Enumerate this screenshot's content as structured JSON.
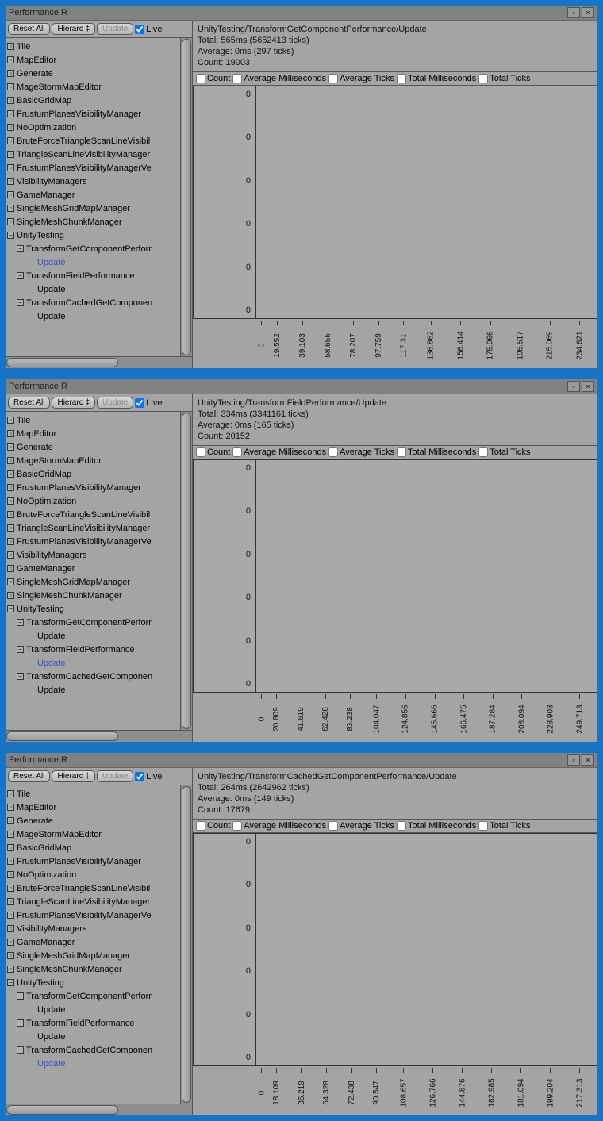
{
  "panels": [
    {
      "title": "Performance R",
      "toolbar": {
        "reset": "Reset All",
        "hierarchy": "Hierarc ‡",
        "update": "Update",
        "live": "Live"
      },
      "tree": [
        {
          "label": "Tile",
          "depth": 0,
          "icon": "square"
        },
        {
          "label": "MapEditor",
          "depth": 0,
          "icon": "square"
        },
        {
          "label": "Generate",
          "depth": 0,
          "icon": "square"
        },
        {
          "label": "MageStormMapEditor",
          "depth": 0,
          "icon": "square"
        },
        {
          "label": "BasicGridMap",
          "depth": 0,
          "icon": "square"
        },
        {
          "label": "FrustumPlanesVisibilityManager",
          "depth": 0,
          "icon": "square"
        },
        {
          "label": "NoOptimization",
          "depth": 0,
          "icon": "square"
        },
        {
          "label": "BruteForceTriangleScanLineVisibil",
          "depth": 0,
          "icon": "square"
        },
        {
          "label": "TriangleScanLineVisibilityManager",
          "depth": 0,
          "icon": "square"
        },
        {
          "label": "FrustumPlanesVisibilityManagerVe",
          "depth": 0,
          "icon": "square"
        },
        {
          "label": "VisibilityManagers",
          "depth": 0,
          "icon": "square"
        },
        {
          "label": "GameManager",
          "depth": 0,
          "icon": "square"
        },
        {
          "label": "SingleMeshGridMapManager",
          "depth": 0,
          "icon": "square"
        },
        {
          "label": "SingleMeshChunkManager",
          "depth": 0,
          "icon": "square"
        },
        {
          "label": "UnityTesting",
          "depth": 0,
          "icon": "minus"
        },
        {
          "label": "TransformGetComponentPerforr",
          "depth": 1,
          "icon": "minus"
        },
        {
          "label": "Update",
          "depth": 2,
          "icon": "blank",
          "selected": true
        },
        {
          "label": "TransformFieldPerformance",
          "depth": 1,
          "icon": "minus"
        },
        {
          "label": "Update",
          "depth": 2,
          "icon": "blank"
        },
        {
          "label": "TransformCachedGetComponen",
          "depth": 1,
          "icon": "minus"
        },
        {
          "label": "Update",
          "depth": 2,
          "icon": "blank"
        }
      ],
      "info": {
        "path": "UnityTesting/TransformGetComponentPerformance/Update",
        "total": "Total: 565ms (5652413 ticks)",
        "avg": "Average: 0ms (297 ticks)",
        "count": "Count: 19003"
      },
      "metrics": [
        "Count",
        "Average Milliseconds",
        "Average Ticks",
        "Total Milliseconds",
        "Total Ticks"
      ],
      "chart_data": {
        "type": "line",
        "y_ticks": [
          "0",
          "0",
          "0",
          "0",
          "0",
          "0"
        ],
        "x_ticks": [
          "0",
          "19.552",
          "39.103",
          "58.655",
          "78.207",
          "97.759",
          "117.31",
          "136.862",
          "156.414",
          "175.966",
          "195.517",
          "215.069",
          "234.621"
        ]
      }
    },
    {
      "title": "Performance R",
      "toolbar": {
        "reset": "Reset All",
        "hierarchy": "Hierarc ‡",
        "update": "Update",
        "live": "Live"
      },
      "tree": [
        {
          "label": "Tile",
          "depth": 0,
          "icon": "square"
        },
        {
          "label": "MapEditor",
          "depth": 0,
          "icon": "square"
        },
        {
          "label": "Generate",
          "depth": 0,
          "icon": "square"
        },
        {
          "label": "MageStormMapEditor",
          "depth": 0,
          "icon": "square"
        },
        {
          "label": "BasicGridMap",
          "depth": 0,
          "icon": "square"
        },
        {
          "label": "FrustumPlanesVisibilityManager",
          "depth": 0,
          "icon": "square"
        },
        {
          "label": "NoOptimization",
          "depth": 0,
          "icon": "square"
        },
        {
          "label": "BruteForceTriangleScanLineVisibil",
          "depth": 0,
          "icon": "square"
        },
        {
          "label": "TriangleScanLineVisibilityManager",
          "depth": 0,
          "icon": "square"
        },
        {
          "label": "FrustumPlanesVisibilityManagerVe",
          "depth": 0,
          "icon": "square"
        },
        {
          "label": "VisibilityManagers",
          "depth": 0,
          "icon": "square"
        },
        {
          "label": "GameManager",
          "depth": 0,
          "icon": "square"
        },
        {
          "label": "SingleMeshGridMapManager",
          "depth": 0,
          "icon": "square"
        },
        {
          "label": "SingleMeshChunkManager",
          "depth": 0,
          "icon": "square"
        },
        {
          "label": "UnityTesting",
          "depth": 0,
          "icon": "minus"
        },
        {
          "label": "TransformGetComponentPerforr",
          "depth": 1,
          "icon": "minus"
        },
        {
          "label": "Update",
          "depth": 2,
          "icon": "blank"
        },
        {
          "label": "TransformFieldPerformance",
          "depth": 1,
          "icon": "minus"
        },
        {
          "label": "Update",
          "depth": 2,
          "icon": "blank",
          "selected": true
        },
        {
          "label": "TransformCachedGetComponen",
          "depth": 1,
          "icon": "minus"
        },
        {
          "label": "Update",
          "depth": 2,
          "icon": "blank"
        }
      ],
      "info": {
        "path": "UnityTesting/TransformFieldPerformance/Update",
        "total": "Total: 334ms (3341161 ticks)",
        "avg": "Average: 0ms (165 ticks)",
        "count": "Count: 20152"
      },
      "metrics": [
        "Count",
        "Average Milliseconds",
        "Average Ticks",
        "Total Milliseconds",
        "Total Ticks"
      ],
      "chart_data": {
        "type": "line",
        "y_ticks": [
          "0",
          "0",
          "0",
          "0",
          "0",
          "0"
        ],
        "x_ticks": [
          "0",
          "20.809",
          "41.619",
          "62.428",
          "83.238",
          "104.047",
          "124.856",
          "145.666",
          "166.475",
          "187.284",
          "208.094",
          "228.903",
          "249.713"
        ]
      }
    },
    {
      "title": "Performance R",
      "toolbar": {
        "reset": "Reset All",
        "hierarchy": "Hierarc ‡",
        "update": "Update",
        "live": "Live"
      },
      "tree": [
        {
          "label": "Tile",
          "depth": 0,
          "icon": "square"
        },
        {
          "label": "MapEditor",
          "depth": 0,
          "icon": "square"
        },
        {
          "label": "Generate",
          "depth": 0,
          "icon": "square"
        },
        {
          "label": "MageStormMapEditor",
          "depth": 0,
          "icon": "square"
        },
        {
          "label": "BasicGridMap",
          "depth": 0,
          "icon": "square"
        },
        {
          "label": "FrustumPlanesVisibilityManager",
          "depth": 0,
          "icon": "square"
        },
        {
          "label": "NoOptimization",
          "depth": 0,
          "icon": "square"
        },
        {
          "label": "BruteForceTriangleScanLineVisibil",
          "depth": 0,
          "icon": "square"
        },
        {
          "label": "TriangleScanLineVisibilityManager",
          "depth": 0,
          "icon": "square"
        },
        {
          "label": "FrustumPlanesVisibilityManagerVe",
          "depth": 0,
          "icon": "square"
        },
        {
          "label": "VisibilityManagers",
          "depth": 0,
          "icon": "square"
        },
        {
          "label": "GameManager",
          "depth": 0,
          "icon": "square"
        },
        {
          "label": "SingleMeshGridMapManager",
          "depth": 0,
          "icon": "square"
        },
        {
          "label": "SingleMeshChunkManager",
          "depth": 0,
          "icon": "square"
        },
        {
          "label": "UnityTesting",
          "depth": 0,
          "icon": "minus"
        },
        {
          "label": "TransformGetComponentPerforr",
          "depth": 1,
          "icon": "minus"
        },
        {
          "label": "Update",
          "depth": 2,
          "icon": "blank"
        },
        {
          "label": "TransformFieldPerformance",
          "depth": 1,
          "icon": "minus"
        },
        {
          "label": "Update",
          "depth": 2,
          "icon": "blank"
        },
        {
          "label": "TransformCachedGetComponen",
          "depth": 1,
          "icon": "minus"
        },
        {
          "label": "Update",
          "depth": 2,
          "icon": "blank",
          "selected": true
        }
      ],
      "info": {
        "path": "UnityTesting/TransformCachedGetComponentPerformance/Update",
        "total": "Total: 264ms (2642962 ticks)",
        "avg": "Average: 0ms (149 ticks)",
        "count": "Count: 17679"
      },
      "metrics": [
        "Count",
        "Average Milliseconds",
        "Average Ticks",
        "Total Milliseconds",
        "Total Ticks"
      ],
      "chart_data": {
        "type": "line",
        "y_ticks": [
          "0",
          "0",
          "0",
          "0",
          "0",
          "0"
        ],
        "x_ticks": [
          "0",
          "18.109",
          "36.219",
          "54.328",
          "72.438",
          "90.547",
          "108.657",
          "126.766",
          "144.876",
          "162.985",
          "181.094",
          "199.204",
          "217.313"
        ]
      }
    }
  ]
}
